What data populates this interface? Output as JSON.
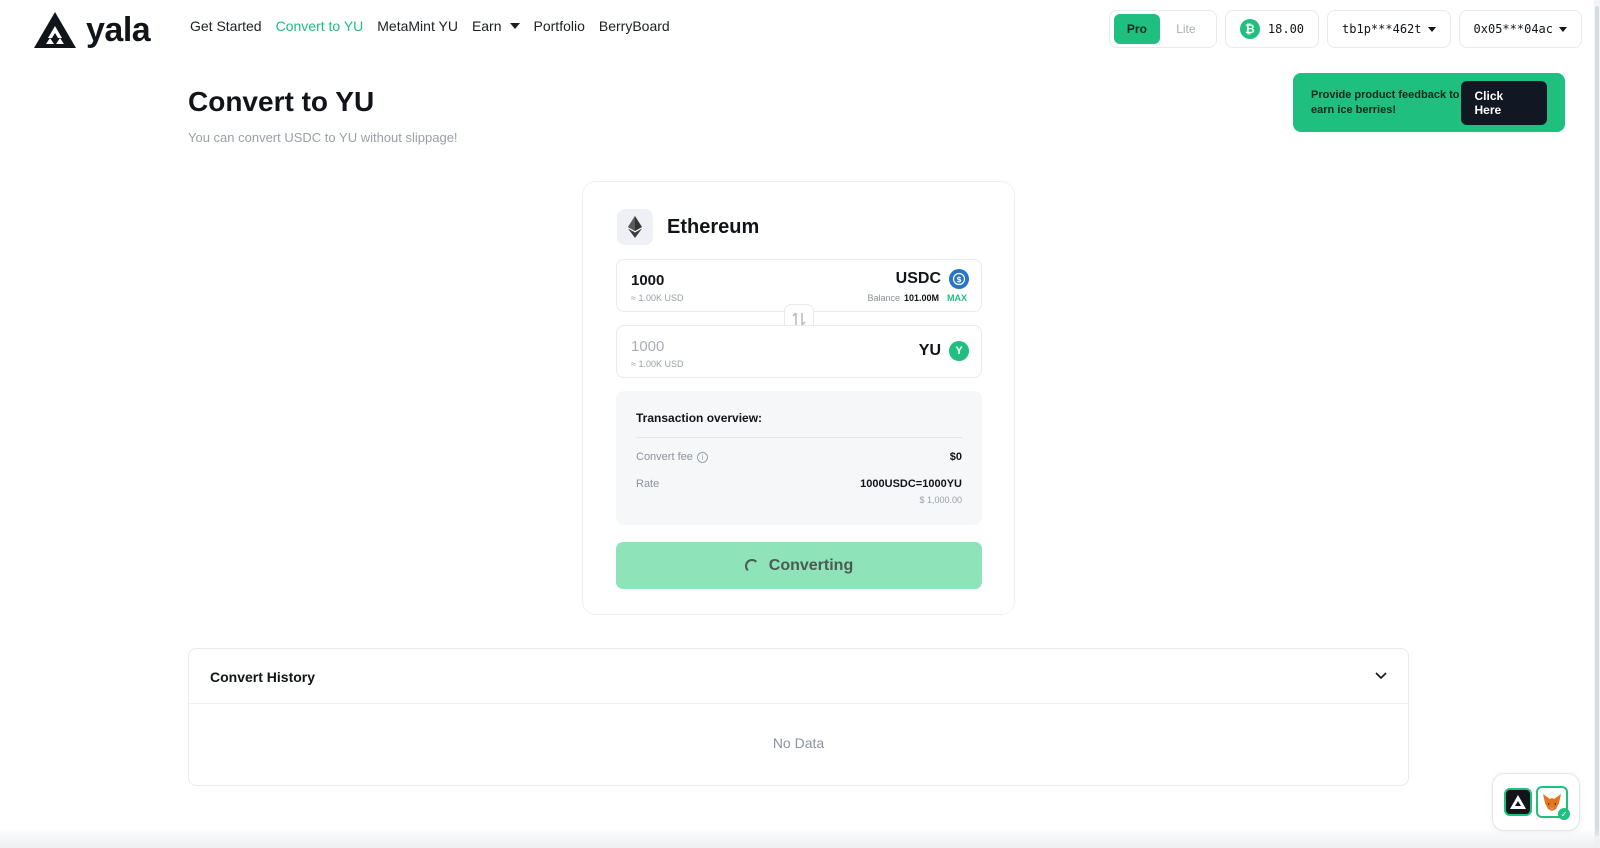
{
  "brand": {
    "name": "yala",
    "accent": "#1fbf7f"
  },
  "nav": [
    {
      "label": "Get Started"
    },
    {
      "label": "Convert to YU",
      "active": true
    },
    {
      "label": "MetaMint YU"
    },
    {
      "label": "Earn",
      "dropdown": true
    },
    {
      "label": "Portfolio"
    },
    {
      "label": "BerryBoard"
    }
  ],
  "header": {
    "mode_pro": "Pro",
    "mode_lite": "Lite",
    "btc_balance": "18.00",
    "btc_address": "tb1p***462t",
    "eth_address": "0x05***04ac"
  },
  "page": {
    "title": "Convert to YU",
    "subtitle": "You can convert USDC to YU without slippage!"
  },
  "feedback": {
    "text": "Provide product feedback to earn ice berries!",
    "button": "Click Here"
  },
  "converter": {
    "network": "Ethereum",
    "from": {
      "amount": "1000",
      "usd": "≈ 1.00K USD",
      "token": "USDC",
      "balance_label": "Balance",
      "balance_value": "101.00M",
      "max_label": "MAX"
    },
    "to": {
      "amount": "1000",
      "usd": "≈ 1.00K USD",
      "token": "YU"
    },
    "overview": {
      "title": "Transaction overview:",
      "fee_label": "Convert fee",
      "fee_value": "$0",
      "rate_label": "Rate",
      "rate_value": "1000USDC=1000YU",
      "rate_usd": "$ 1,000.00"
    },
    "action_label": "Converting"
  },
  "history": {
    "title": "Convert History",
    "empty": "No Data"
  }
}
